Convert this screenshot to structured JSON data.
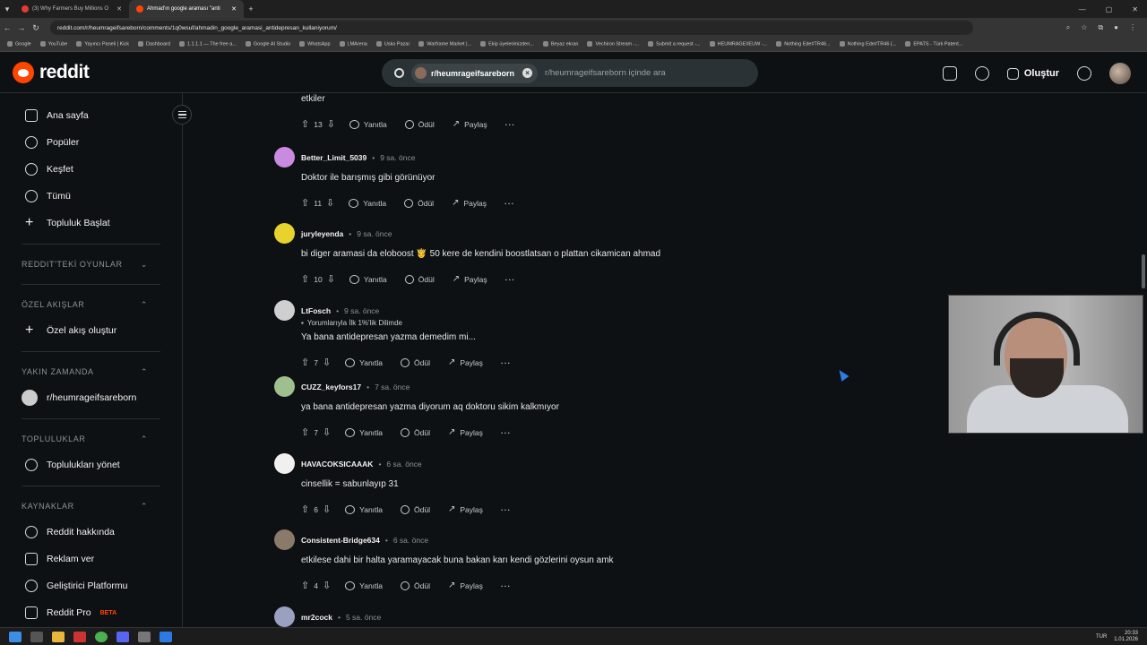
{
  "browser": {
    "tabs": [
      {
        "title": "(3) Why Farmers Buy Millions O",
        "active": false
      },
      {
        "title": "Ahmad'ın google araması \"anti",
        "active": true
      }
    ],
    "new_tab": "+",
    "url": "reddit.com/r/heumrageifsareborn/comments/1q0wsuf/ahmadin_google_aramasi_antidepresan_kullaniyorum/",
    "bookmarks": [
      "Google",
      "YouTube",
      "Yayıncı Paneli | Kick",
      "Dashboard",
      "1.1.1.1 — The free a...",
      "Google AI Studio",
      "WhatsApp",
      "LMArena",
      "Usko Pazar",
      "Warframe Market |...",
      "Ekip üyelerimizden...",
      "Beyaz ekran",
      "Vechiron Stream -...",
      "Submit a request -...",
      "HEUMRAGE#EUW -...",
      "Nothing Ede#TR46...",
      "Nothing Ede#TR46 (...",
      "EPATS - Türk Patent..."
    ]
  },
  "header": {
    "logo_text": "reddit",
    "search_chip": "r/heumrageifsareborn",
    "search_placeholder": "r/heumrageifsareborn içinde ara",
    "create_label": "Oluştur"
  },
  "sidebar": {
    "main_items": [
      {
        "label": "Ana sayfa",
        "icon": "home-icon"
      },
      {
        "label": "Popüler",
        "icon": "popular-icon"
      },
      {
        "label": "Keşfet",
        "icon": "explore-icon"
      },
      {
        "label": "Tümü",
        "icon": "all-icon"
      },
      {
        "label": "Topluluk Başlat",
        "icon": "plus-icon"
      }
    ],
    "sections": {
      "games": "REDDIT'TEKİ OYUNLAR",
      "custom_feeds": "ÖZEL AKIŞLAR",
      "create_feed": "Özel akış oluştur",
      "recent": "YAKIN ZAMANDA",
      "recent_item": "r/heumrageifsareborn",
      "communities": "TOPLULUKLAR",
      "manage_communities": "Toplulukları yönet",
      "resources": "KAYNAKLAR",
      "about": "Reddit hakkında",
      "advertise": "Reklam ver",
      "dev_platform": "Geliştirici Platformu",
      "reddit_pro": "Reddit Pro",
      "beta": "BETA"
    }
  },
  "comments": [
    {
      "text": "etkiler",
      "votes": "13",
      "partial": true
    },
    {
      "user": "Better_Limit_5039",
      "time": "9 sa. önce",
      "text": "Doktor ile barışmış gibi görünüyor",
      "votes": "11",
      "avatar_color": "#c98be0"
    },
    {
      "user": "juryleyenda",
      "time": "9 sa. önce",
      "text": "bi diger aramasi da eloboost 🤴 50 kere de kendini boostlatsan o plattan cikamican ahmad",
      "votes": "10",
      "avatar_color": "#e8d22c"
    },
    {
      "user": "LtFosch",
      "time": "9 sa. önce",
      "flair": "Yorumlarıyla İlk 1%'lik Dilimde",
      "text": "Ya bana antidepresan yazma demedim mi...",
      "votes": "7",
      "avatar_color": "#cfcfcf"
    },
    {
      "user": "CUZZ_keyfors17",
      "time": "7 sa. önce",
      "text": "ya bana antidepresan yazma diyorum aq doktoru sikim kalkmıyor",
      "votes": "7",
      "avatar_color": "#9fbf8f"
    },
    {
      "user": "HAVACOKSICAAAK",
      "time": "6 sa. önce",
      "text": "cinsellik = sabunlayıp 31",
      "votes": "6",
      "avatar_color": "#f0f0f0"
    },
    {
      "user": "Consistent-Bridge634",
      "time": "6 sa. önce",
      "text": "etkilese dahi bir halta yaramayacak buna bakan karı kendi gözlerini oysun amk",
      "votes": "4",
      "avatar_color": "#8a7a6a"
    },
    {
      "user": "mr2cock",
      "time": "5 sa. önce",
      "avatar_color": "#9aa0c0"
    }
  ],
  "actions": {
    "reply": "Yanıtla",
    "award": "Ödül",
    "share": "Paylaş",
    "more": "···"
  },
  "taskbar": {
    "lang": "TUR",
    "time": "20:33",
    "date": "1.01.2026"
  },
  "colors": {
    "bg": "#0e1113",
    "reddit_orange": "#ff4500",
    "text": "#d7dadc",
    "muted": "#8b9296"
  }
}
